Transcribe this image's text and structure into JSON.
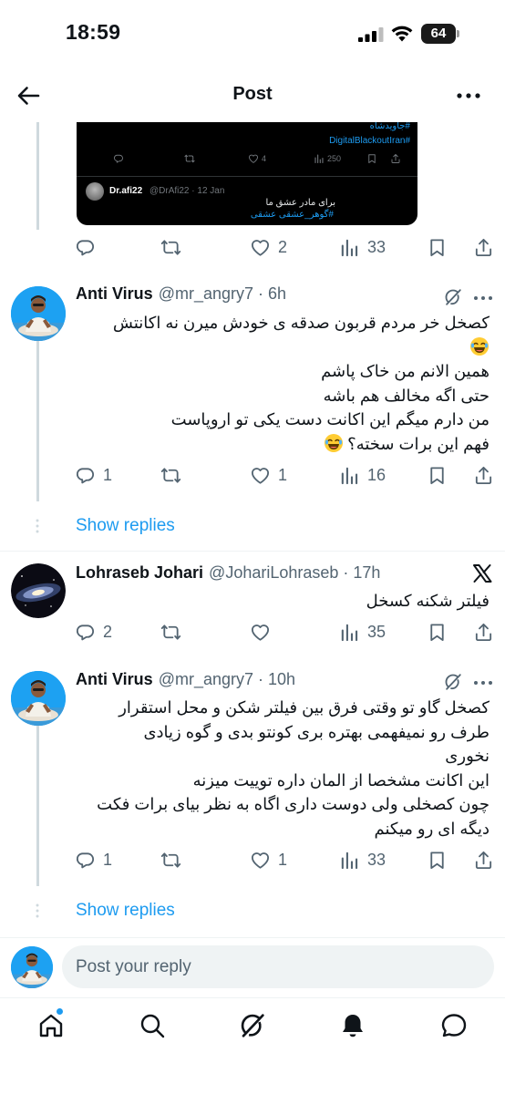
{
  "status_bar": {
    "time": "18:59",
    "battery": "64"
  },
  "header": {
    "title": "Post"
  },
  "quoted_post": {
    "hashtag_1": "#جاویدشاه",
    "hashtag_2": "#DigitalBlackoutIran",
    "likes": "4",
    "views": "250",
    "reply": {
      "name": "Dr.afi22",
      "meta": "@DrAfi22 · 12 Jan",
      "text": "برای مادر عشق ما",
      "hashtag": "#گوهر_عشقی عشقی"
    }
  },
  "main_post_actions": {
    "replies": "",
    "reposts": "",
    "likes": "2",
    "views": "33"
  },
  "posts": [
    {
      "name": "Anti Virus",
      "meta": "@mr_angry7 · 6h",
      "lines": [
        "کصخل خر مردم قربون صدقه ی خودش میرن نه اکانتش",
        "",
        "همین الانم من خاک پاشم",
        "حتی اگه مخالف هم باشه",
        "من دارم میگم این اکانت دست یکی تو اروپاست",
        "فهم این برات سخته؟"
      ],
      "actions": {
        "replies": "1",
        "reposts": "",
        "likes": "1",
        "views": "16"
      },
      "show_replies": "Show replies"
    },
    {
      "name": "Lohraseb Johari",
      "meta": "@JohariLohraseb · 17h",
      "lines": [
        "فیلتر شکنه کسخل"
      ],
      "actions": {
        "replies": "2",
        "reposts": "",
        "likes": "",
        "views": "35"
      }
    },
    {
      "name": "Anti Virus",
      "meta": "@mr_angry7 · 10h",
      "lines": [
        "کصخل گاو تو وقتی فرق بین فیلتر شکن و محل استقرار",
        "طرف رو نمیفهمی بهتره بری کونتو بدی و گوه زیادی",
        "نخوری",
        "این اکانت مشخصا از المان داره توییت میزنه",
        "چون کصخلی ولی دوست داری اگاه به نظر بیای برات فکت",
        "دیگه ای رو میکنم"
      ],
      "actions": {
        "replies": "1",
        "reposts": "",
        "likes": "1",
        "views": "33"
      },
      "show_replies": "Show replies"
    }
  ],
  "reply_bar": {
    "placeholder": "Post your reply"
  },
  "bottom_nav": [
    "home-icon",
    "search-icon",
    "grok-icon",
    "notifications-icon",
    "messages-icon"
  ],
  "colors": {
    "accent": "#1d9bf0",
    "text": "#0f1419",
    "secondary": "#536471",
    "divider": "#eff3f4"
  }
}
